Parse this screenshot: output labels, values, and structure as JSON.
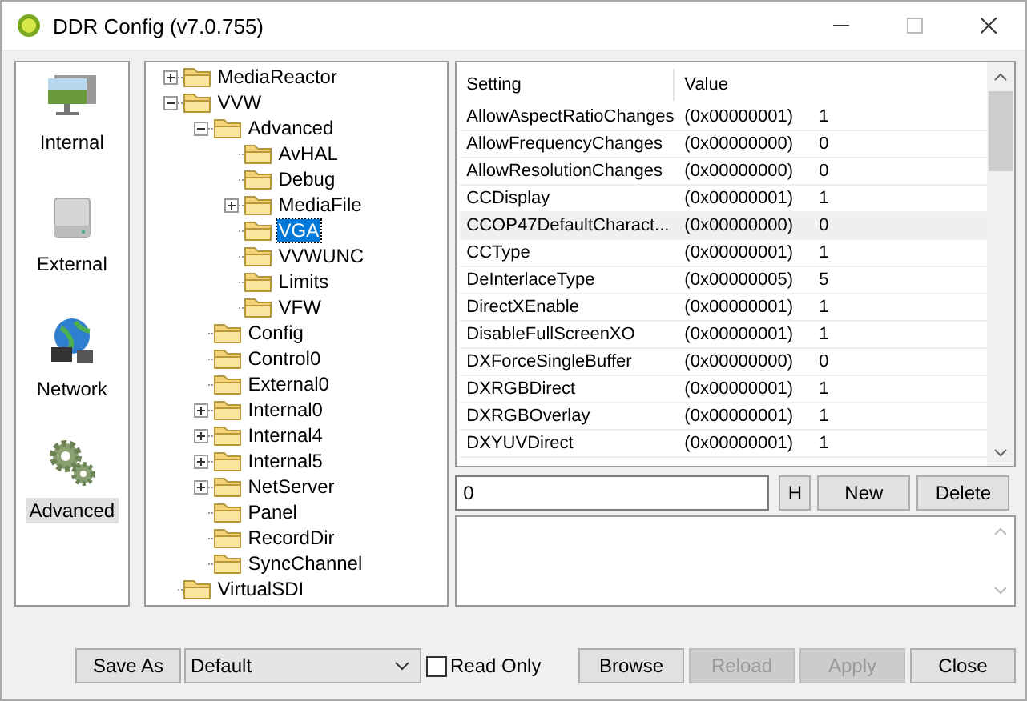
{
  "window": {
    "title": "DDR Config (v7.0.755)"
  },
  "sidebar": {
    "items": [
      {
        "label": "Internal",
        "kind": "monitor",
        "selected": false
      },
      {
        "label": "External",
        "kind": "drive",
        "selected": false
      },
      {
        "label": "Network",
        "kind": "globe",
        "selected": false
      },
      {
        "label": "Advanced",
        "kind": "gears",
        "selected": true
      }
    ]
  },
  "tree": [
    {
      "label": "MediaReactor",
      "expanded": false,
      "selected": false
    },
    {
      "label": "VVW",
      "expanded": true,
      "selected": false,
      "children": [
        {
          "label": "Advanced",
          "expanded": true,
          "selected": false,
          "children": [
            {
              "label": "AvHAL",
              "selected": false
            },
            {
              "label": "Debug",
              "selected": false
            },
            {
              "label": "MediaFile",
              "expanded": false,
              "selected": false
            },
            {
              "label": "VGA",
              "selected": true
            },
            {
              "label": "VVWUNC",
              "selected": false
            },
            {
              "label": "Limits",
              "selected": false
            },
            {
              "label": "VFW",
              "selected": false
            }
          ]
        },
        {
          "label": "Config",
          "selected": false
        },
        {
          "label": "Control0",
          "selected": false
        },
        {
          "label": "External0",
          "selected": false
        },
        {
          "label": "Internal0",
          "expanded": false,
          "selected": false
        },
        {
          "label": "Internal4",
          "expanded": false,
          "selected": false
        },
        {
          "label": "Internal5",
          "expanded": false,
          "selected": false
        },
        {
          "label": "NetServer",
          "expanded": false,
          "selected": false
        },
        {
          "label": "Panel",
          "selected": false
        },
        {
          "label": "RecordDir",
          "selected": false
        },
        {
          "label": "SyncChannel",
          "selected": false
        }
      ]
    },
    {
      "label": "VirtualSDI",
      "selected": false
    }
  ],
  "table": {
    "columns": [
      "Setting",
      "Value"
    ],
    "rows": [
      {
        "setting": "AllowAspectRatioChanges",
        "hex": "(0x00000001)",
        "value": "1",
        "highlighted": false
      },
      {
        "setting": "AllowFrequencyChanges",
        "hex": "(0x00000000)",
        "value": "0",
        "highlighted": false
      },
      {
        "setting": "AllowResolutionChanges",
        "hex": "(0x00000000)",
        "value": "0",
        "highlighted": false
      },
      {
        "setting": "CCDisplay",
        "hex": "(0x00000001)",
        "value": "1",
        "highlighted": false
      },
      {
        "setting": "CCOP47DefaultCharact...",
        "hex": "(0x00000000)",
        "value": "0",
        "highlighted": true
      },
      {
        "setting": "CCType",
        "hex": "(0x00000001)",
        "value": "1",
        "highlighted": false
      },
      {
        "setting": "DeInterlaceType",
        "hex": "(0x00000005)",
        "value": "5",
        "highlighted": false
      },
      {
        "setting": "DirectXEnable",
        "hex": "(0x00000001)",
        "value": "1",
        "highlighted": false
      },
      {
        "setting": "DisableFullScreenXO",
        "hex": "(0x00000001)",
        "value": "1",
        "highlighted": false
      },
      {
        "setting": "DXForceSingleBuffer",
        "hex": "(0x00000000)",
        "value": "0",
        "highlighted": false
      },
      {
        "setting": "DXRGBDirect",
        "hex": "(0x00000001)",
        "value": "1",
        "highlighted": false
      },
      {
        "setting": "DXRGBOverlay",
        "hex": "(0x00000001)",
        "value": "1",
        "highlighted": false
      },
      {
        "setting": "DXYUVDirect",
        "hex": "(0x00000001)",
        "value": "1",
        "highlighted": false
      }
    ]
  },
  "editor": {
    "value": "0",
    "buttons": [
      {
        "label": "H",
        "kind": "small"
      },
      {
        "label": "New",
        "kind": "normal"
      },
      {
        "label": "Delete",
        "kind": "normal"
      }
    ]
  },
  "footer": {
    "save_as": "Save As",
    "profile": "Default",
    "read_only": {
      "label": "Read Only",
      "checked": false
    },
    "buttons": [
      {
        "label": "Browse",
        "disabled": false
      },
      {
        "label": "Reload",
        "disabled": true
      },
      {
        "label": "Apply",
        "disabled": true
      },
      {
        "label": "Close",
        "disabled": false
      }
    ]
  }
}
